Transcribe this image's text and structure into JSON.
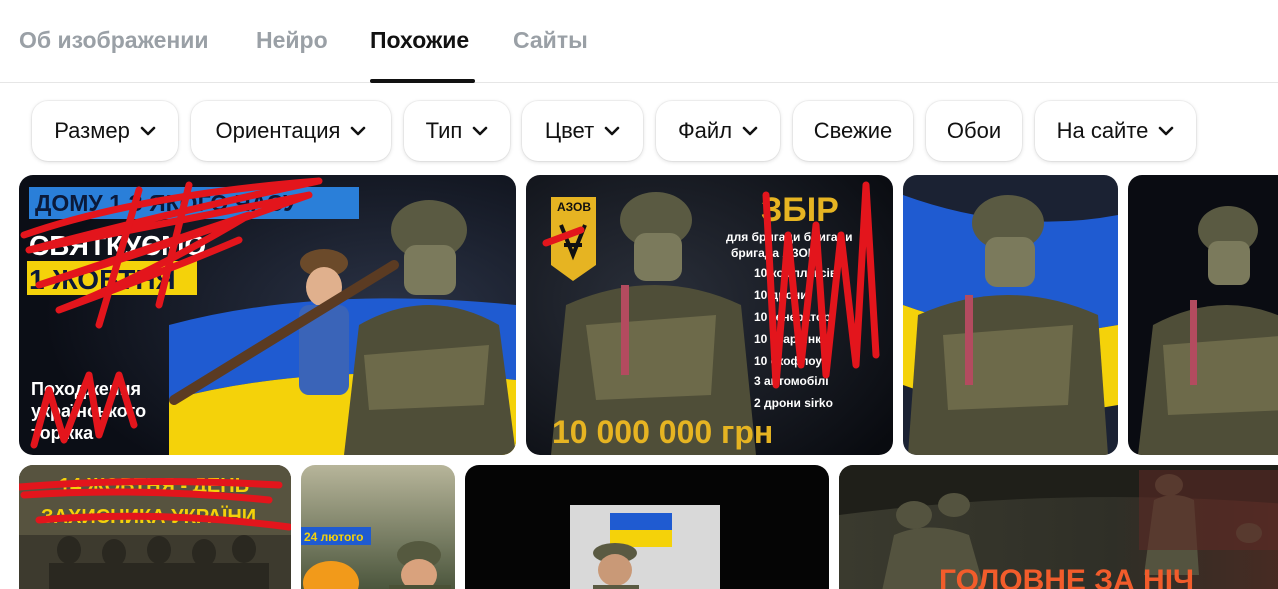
{
  "tabs": [
    {
      "label": "Об изображении"
    },
    {
      "label": "Нейро"
    },
    {
      "label": "Похожие",
      "active": true
    },
    {
      "label": "Сайты"
    }
  ],
  "filters": [
    {
      "label": "Размер",
      "dropdown": true
    },
    {
      "label": "Ориентация",
      "dropdown": true
    },
    {
      "label": "Тип",
      "dropdown": true
    },
    {
      "label": "Цвет",
      "dropdown": true
    },
    {
      "label": "Файл",
      "dropdown": true
    },
    {
      "label": "Свежие",
      "dropdown": false
    },
    {
      "label": "Обои",
      "dropdown": false
    },
    {
      "label": "На сайте",
      "dropdown": true
    }
  ],
  "results": {
    "row1": [
      {
        "overlay_top": "ДОМУ 1 З ЯКОГО ЧАСУ",
        "overlay_mid1": "СВЯТКУЄМО",
        "overlay_mid2": "1 ЖОВТНЯ",
        "overlay_bottom1": "Походження",
        "overlay_bottom2": "українського",
        "overlay_bottom3": "торжка"
      },
      {
        "badge": "АЗОВ",
        "headline": "ЗБІР",
        "sub1": "для бригади бригади",
        "sub2": "бригада АЗОВ",
        "list": [
          "10 комплексів",
          "10 дрони",
          "10 генератор",
          "10 старлінк",
          "10 екофлоу",
          "3 автомобілі",
          "2 дрони sirko"
        ],
        "amount": "10 000 000 грн"
      },
      {},
      {}
    ],
    "row2": [
      {
        "overlay_line1": "14 ЖОВТНЯ - ДЕНЬ",
        "overlay_line2": "ЗАХИСНИКА УКРАЇНИ"
      },
      {
        "date_label": "24 лютого"
      },
      {},
      {
        "headline": "ГОЛОВНЕ ЗА НІЧ"
      }
    ]
  },
  "colors": {
    "accent_red": "#e3151c",
    "ukraine_blue": "#1f5bd1",
    "ukraine_yellow": "#f4d20a",
    "azov_gold": "#e6b422"
  }
}
